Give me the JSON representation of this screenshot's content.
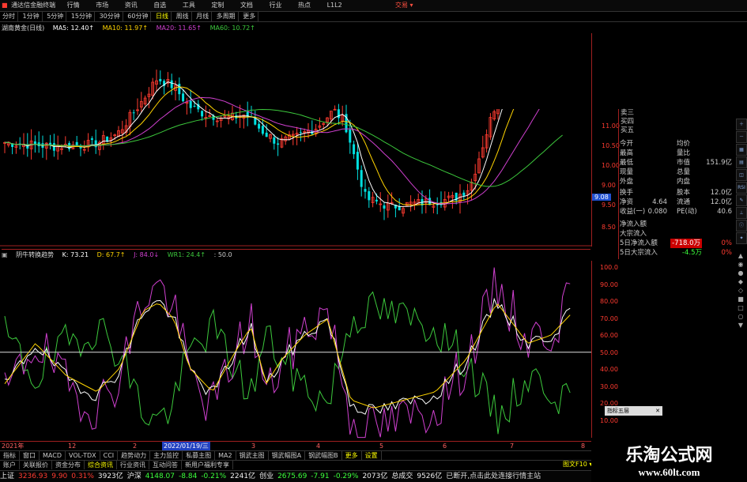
{
  "window": {
    "title": "通达信金融终端",
    "right_label": "交易 ▾"
  },
  "menu": [
    "行情",
    "市场",
    "资讯",
    "自选",
    "工具",
    "定制",
    "文档",
    "行业",
    "热点",
    "L1L2"
  ],
  "periods": [
    "分时",
    "1分钟",
    "5分钟",
    "15分钟",
    "30分钟",
    "60分钟",
    "日线",
    "周线",
    "月线",
    "多周期",
    "更多"
  ],
  "ma_line": {
    "name": "湖南黄金(日线)",
    "items": [
      {
        "label": "MA5: 12.40↑",
        "color": "#ffffff"
      },
      {
        "label": "MA10: 11.97↑",
        "color": "#ffd400"
      },
      {
        "label": "MA20: 11.65↑",
        "color": "#d040d0"
      },
      {
        "label": "MA60: 10.72↑",
        "color": "#3cc83c"
      }
    ]
  },
  "price_axis": [
    "11.00",
    "10.50",
    "10.00",
    "9.50",
    "9.00",
    "8.50"
  ],
  "price_tag": "9.08",
  "quote": {
    "top": [
      "卖三",
      "买四",
      "买五"
    ],
    "rows": [
      {
        "k": "今开",
        "v": "",
        "k2": "均价",
        "v2": ""
      },
      {
        "k": "最高",
        "v": "",
        "k2": "量比",
        "v2": ""
      },
      {
        "k": "最低",
        "v": "",
        "k2": "市值",
        "v2": "151.9亿"
      },
      {
        "k": "现量",
        "v": "",
        "k2": "总量",
        "v2": ""
      },
      {
        "k": "外盘",
        "v": "",
        "k2": "内盘",
        "v2": ""
      },
      {
        "k": "换手",
        "v": "",
        "k2": "股本",
        "v2": "12.0亿"
      },
      {
        "k": "净资",
        "v": "4.64",
        "k2": "流通",
        "v2": "12.0亿"
      },
      {
        "k": "收益(一)",
        "v": "0.080",
        "k2": "PE(动)",
        "v2": "40.6"
      }
    ],
    "flows": [
      {
        "k": "净流入额",
        "v": "",
        "pct": ""
      },
      {
        "k": "大宗流入",
        "v": "",
        "pct": ""
      },
      {
        "k": "5日净流入额",
        "v": "-718.0万",
        "pct": "0%"
      },
      {
        "k": "5日大宗流入",
        "v": "-4.5万",
        "pct": "0%"
      }
    ]
  },
  "indicator_line": {
    "name": "阴牛转换趋势",
    "items": [
      {
        "label": "K: 73.21",
        "color": "#ffffff"
      },
      {
        "label": "D: 67.7↑",
        "color": "#ffd400"
      },
      {
        "label": "J: 84.0↓",
        "color": "#d040d0"
      },
      {
        "label": "WR1: 24.4↑",
        "color": "#3cc83c"
      },
      {
        "label": ": 50.0",
        "color": "#cccccc"
      }
    ]
  },
  "ind_axis": [
    "100.0",
    "90.00",
    "80.00",
    "70.00",
    "60.00",
    "50.00",
    "40.00",
    "30.00",
    "20.00",
    "10.00"
  ],
  "date_axis": {
    "year": "2021年",
    "m1": "12",
    "m2": "2",
    "m3": "3",
    "m4": "4",
    "m5": "5",
    "m6": "6",
    "m7": "7",
    "m8": "8",
    "highlight": "2022/01/19/三"
  },
  "popup_label": "指标五层",
  "indicator_tabs": [
    "指标",
    "窗口",
    "MACD",
    "VOL-TDX",
    "CCI",
    "趋势动力",
    "主力监控",
    "私募主图",
    "MA2",
    "钢武主图",
    "钢武幅图A",
    "钢武幅图B",
    "更多",
    "设置"
  ],
  "bottom_tabs": [
    "账户",
    "关联报价",
    "资金分布",
    "综合资讯",
    "行业资讯",
    "互动问答",
    "新用户福利专享"
  ],
  "bottom_right": "图文F10 ▾",
  "ticker": [
    {
      "t": "上证",
      "c": "white"
    },
    {
      "t": "3236.93",
      "c": "red"
    },
    {
      "t": "9.90",
      "c": "red"
    },
    {
      "t": "0.31%",
      "c": "red"
    },
    {
      "t": "3923亿",
      "c": "white"
    },
    {
      "t": "沪深",
      "c": "white"
    },
    {
      "t": "4148.07",
      "c": "green"
    },
    {
      "t": "-8.84",
      "c": "green"
    },
    {
      "t": "-0.21%",
      "c": "green"
    },
    {
      "t": "2241亿",
      "c": "white"
    },
    {
      "t": "创业",
      "c": "white"
    },
    {
      "t": "2675.69",
      "c": "green"
    },
    {
      "t": "-7.91",
      "c": "green"
    },
    {
      "t": "-0.29%",
      "c": "green"
    },
    {
      "t": "2073亿",
      "c": "white"
    },
    {
      "t": "总成交",
      "c": "white"
    },
    {
      "t": "9526亿",
      "c": "white"
    },
    {
      "t": "已断开,点击此处连接行情主站",
      "c": "white"
    }
  ],
  "watermark": {
    "title": "乐淘公式网",
    "url": "www.60lt.com"
  },
  "colors": {
    "up": "#ff3b30",
    "down": "#00e0e0",
    "ma5": "#ffffff",
    "ma10": "#ffd400",
    "ma20": "#d040d0",
    "ma60": "#3cc83c"
  }
}
